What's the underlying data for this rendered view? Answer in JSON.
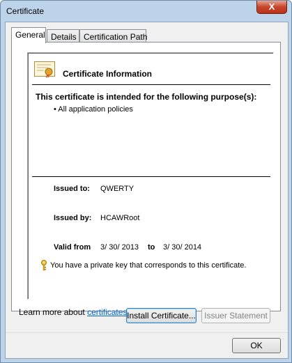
{
  "window": {
    "title": "Certificate",
    "close_glyph": "X"
  },
  "tabs": [
    {
      "label": "General",
      "active": true
    },
    {
      "label": "Details",
      "active": false
    },
    {
      "label": "Certification Path",
      "active": false
    }
  ],
  "general": {
    "header_title": "Certificate Information",
    "purpose_heading": "This certificate is intended for the following purpose(s):",
    "purposes": [
      "• All application policies"
    ],
    "issued_to_label": "Issued to:",
    "issued_to_value": "QWERTY",
    "issued_by_label": "Issued by:",
    "issued_by_value": "HCAWRoot",
    "valid_from_label": "Valid from",
    "valid_from_value": "3/ 30/ 2013",
    "valid_to_label": "to",
    "valid_to_value": "3/ 30/ 2014",
    "private_key_text": "You have a private key that corresponds to this certificate."
  },
  "buttons": {
    "install": "Install Certificate...",
    "issuer_statement": "Issuer Statement",
    "ok": "OK"
  },
  "learn_more": {
    "prefix": "Learn more about ",
    "link": "certificates"
  },
  "icons": {
    "certificate": "certificate-icon",
    "key": "key-icon"
  }
}
